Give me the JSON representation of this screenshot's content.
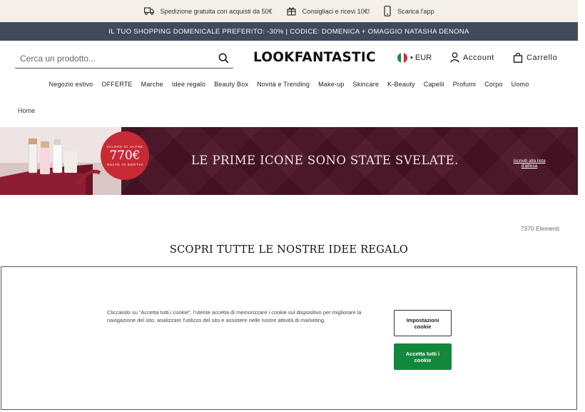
{
  "topbar": {
    "perks": [
      {
        "icon": "truck-icon",
        "label": "Spedizione gratuita con acquisti da 50€"
      },
      {
        "icon": "gift-icon",
        "label": "Consigliaci e ricevi 10€!"
      },
      {
        "icon": "phone-icon",
        "label": "Scarica l'app"
      }
    ]
  },
  "promo": {
    "text": "IL TUO SHOPPING DOMENICALE PREFERITO: -30% | CODICE: DOMENICA + OMAGGIO NATASHA DENONA"
  },
  "header": {
    "search_placeholder": "Cerca un prodotto...",
    "logo": "LOOKFANTASTIC",
    "currency": "• EUR",
    "account_label": "Account",
    "cart_label": "Carrello"
  },
  "nav": {
    "items": [
      "Negozio estivo",
      "OFFERTE",
      "Marche",
      "Idee regalo",
      "Beauty Box",
      "Novità e Trending",
      "Make-up",
      "Skincare",
      "K-Beauty",
      "Capelli",
      "Profumi",
      "Corpo",
      "Uomo"
    ]
  },
  "breadcrumb": {
    "home": "Home"
  },
  "banner": {
    "headline": "LE PRIME ICONE SONO STATE SVELATE.",
    "badge_top": "VALORE DI OLTRE",
    "badge_amount": "770€",
    "badge_bottom": "VALORE DI OLTRE",
    "cta": "Iscriviti alla lista d'attesa"
  },
  "listing": {
    "count": "7370 Elementi",
    "title": "SCOPRI TUTTE LE NOSTRE IDEE REGALO"
  },
  "cookie": {
    "text": "Cliccando su “Accetta tutti i cookie”, l'utente accetta di memorizzare i cookie sul dispositivo per migliorare la navigazione del sito, analizzare l'utilizzo del sito e assistere nelle nostre attività di marketing.",
    "settings_label": "Impostazioni cookie",
    "accept_label": "Accetta tutti i cookie"
  },
  "colors": {
    "topbar_bg": "#f4efe7",
    "promo_bg": "#3f4a5c",
    "banner_bg": "#4a1426",
    "badge_red": "#c72a35",
    "accept_green": "#13873b"
  }
}
